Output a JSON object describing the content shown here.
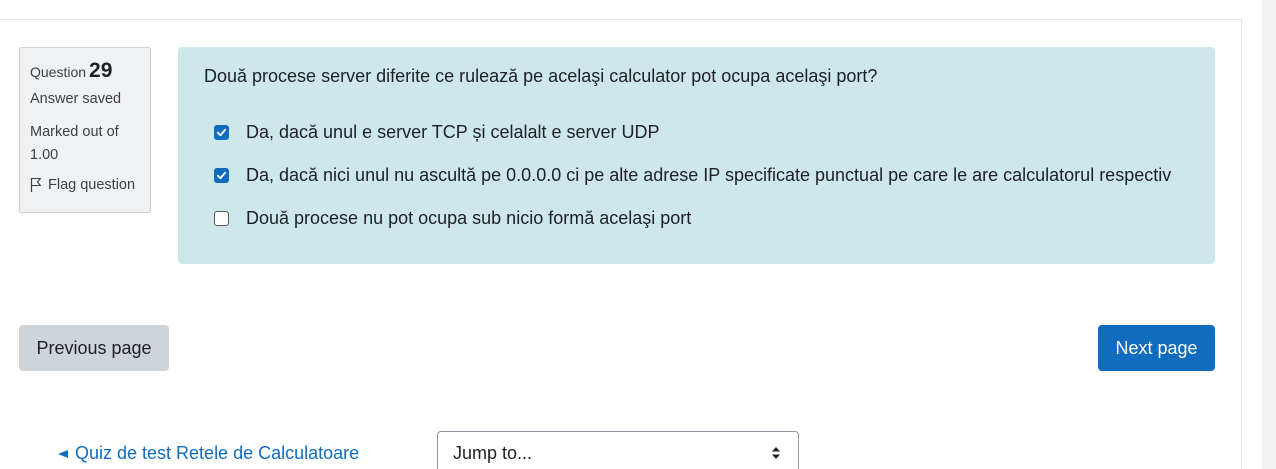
{
  "question_info": {
    "question_prefix": "Question",
    "question_number": "29",
    "state": "Answer saved",
    "grade": "Marked out of 1.00",
    "flag_label": "Flag question"
  },
  "question": {
    "text": "Două procese server diferite ce rulează pe acelaşi calculator pot ocupa acelaşi port?",
    "answers": [
      {
        "label": "Da, dacă unul e server TCP și celalalt e server UDP",
        "checked": true
      },
      {
        "label": "Da, dacă nici unul nu ascultă pe 0.0.0.0 ci pe alte adrese IP specificate punctual pe care le are calculatorul respectiv",
        "checked": true
      },
      {
        "label": "Două procese nu pot ocupa sub nicio formă acelaşi port",
        "checked": false
      }
    ]
  },
  "navigation": {
    "previous_label": "Previous page",
    "next_label": "Next page",
    "back_link": "Quiz de test Retele de Calculatoare",
    "jump_select": "Jump to..."
  },
  "colors": {
    "accent": "#0f6cbf",
    "question_bg": "#cee7eb",
    "info_bg": "#f0f1f2",
    "secondary_button": "#ced4da"
  },
  "icons": [
    "flag-icon",
    "checkbox-checked-icon",
    "checkbox-empty-icon",
    "back-arrow-icon",
    "select-arrows-icon"
  ]
}
